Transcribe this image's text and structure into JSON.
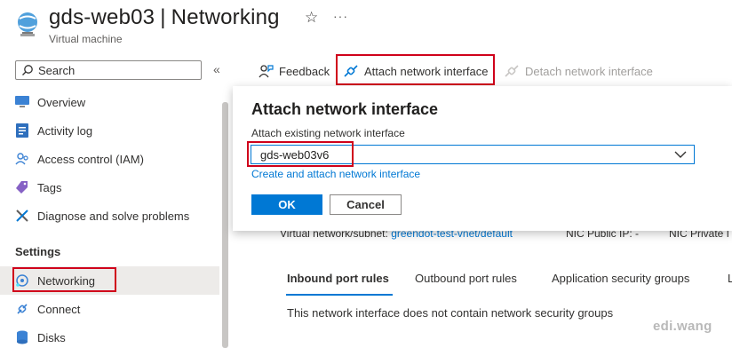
{
  "header": {
    "resource_name": "gds-web03",
    "separator": "|",
    "blade_name": "Networking",
    "subtitle": "Virtual machine",
    "icons": [
      "virtual-machine-icon",
      "star-icon",
      "more-icon"
    ]
  },
  "sidebar": {
    "search_placeholder": "Search",
    "collapse_glyph": "«",
    "items": [
      {
        "label": "Overview",
        "icon": "overview-icon"
      },
      {
        "label": "Activity log",
        "icon": "activity-log-icon"
      },
      {
        "label": "Access control (IAM)",
        "icon": "iam-icon"
      },
      {
        "label": "Tags",
        "icon": "tag-icon"
      },
      {
        "label": "Diagnose and solve problems",
        "icon": "diagnose-icon"
      }
    ],
    "section_settings": "Settings",
    "settings_items": [
      {
        "label": "Networking",
        "icon": "networking-icon",
        "selected": true
      },
      {
        "label": "Connect",
        "icon": "connect-icon"
      },
      {
        "label": "Disks",
        "icon": "disks-icon"
      }
    ]
  },
  "toolbar": {
    "feedback": "Feedback",
    "attach": "Attach network interface",
    "detach": "Detach network interface"
  },
  "flyout": {
    "title": "Attach network interface",
    "field_label": "Attach existing network interface",
    "selected_value": "gds-web03v6",
    "create_link": "Create and attach network interface",
    "ok": "OK",
    "cancel": "Cancel"
  },
  "details": {
    "vnet_label": "Virtual network/subnet:",
    "vnet_value": "greendot-test-vnet/default",
    "public_ip_label": "NIC Public IP:",
    "public_ip_value": "-",
    "private_ip_label": "NIC Private I"
  },
  "tabs": [
    "Inbound port rules",
    "Outbound port rules",
    "Application security groups",
    "L"
  ],
  "empty_message": "This network interface does not contain network security groups",
  "watermark": "edi.wang",
  "colors": {
    "accent": "#0078d4",
    "highlight": "#d0021b",
    "selected_bg": "#edebe9"
  }
}
